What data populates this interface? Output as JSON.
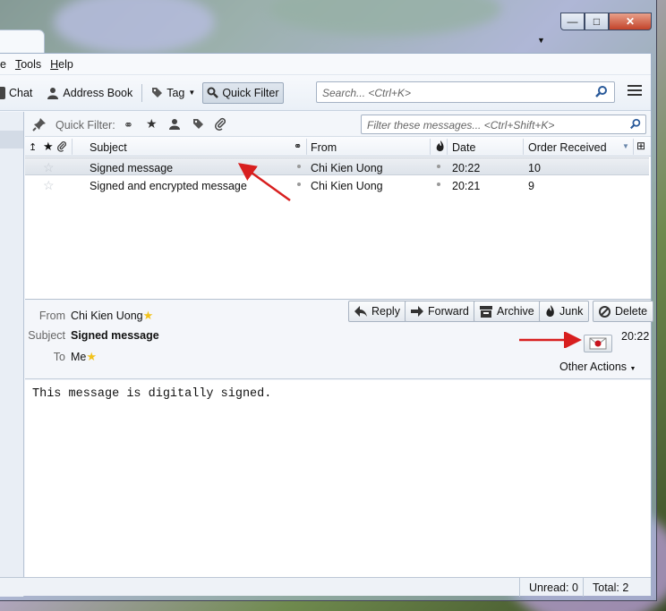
{
  "menubar": {
    "items": [
      "e",
      "Tools",
      "Help"
    ]
  },
  "toolbar": {
    "chat_label": "Chat",
    "address_book_label": "Address Book",
    "tag_label": "Tag",
    "quick_filter_label": "Quick Filter",
    "search_placeholder": "Search... <Ctrl+K>"
  },
  "quick_filter": {
    "label": "Quick Filter:",
    "placeholder": "Filter these messages... <Ctrl+Shift+K>"
  },
  "thread": {
    "columns": {
      "subject": "Subject",
      "from": "From",
      "date": "Date",
      "order": "Order Received"
    },
    "rows": [
      {
        "subject": "Signed message",
        "from": "Chi Kien Uong",
        "date": "20:22",
        "order": "10"
      },
      {
        "subject": "Signed and encrypted message",
        "from": "Chi Kien Uong",
        "date": "20:21",
        "order": "9"
      }
    ]
  },
  "header": {
    "from_label": "From",
    "from_value": "Chi Kien Uong",
    "subject_label": "Subject",
    "subject_value": "Signed message",
    "to_label": "To",
    "to_value": "Me",
    "time": "20:22",
    "other_actions": "Other Actions",
    "actions": {
      "reply": "Reply",
      "forward": "Forward",
      "archive": "Archive",
      "junk": "Junk",
      "delete": "Delete"
    }
  },
  "body": {
    "text": "This message is digitally signed."
  },
  "status": {
    "unread": "Unread: 0",
    "total": "Total: 2"
  },
  "colors": {
    "accent_red": "#d81f1f",
    "star_yellow": "#f2c21b"
  }
}
